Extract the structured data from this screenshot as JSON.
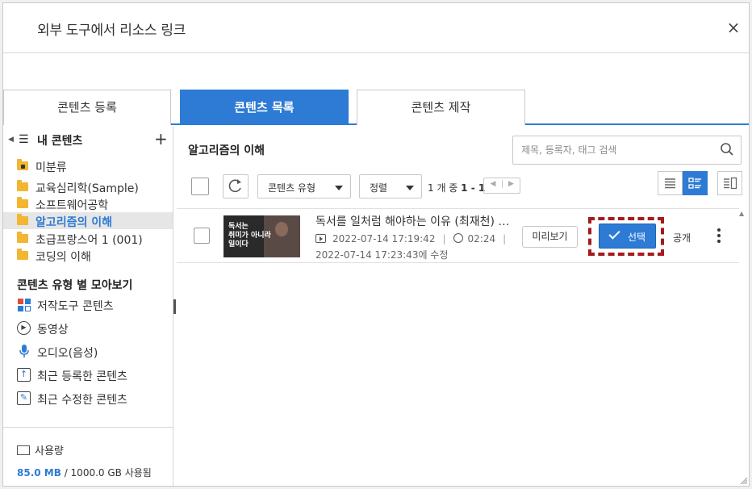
{
  "dialog": {
    "title": "외부 도구에서 리소스 링크",
    "close_symbol": "×"
  },
  "tabs": [
    {
      "label": "콘텐츠 등록",
      "active": false
    },
    {
      "label": "콘텐츠 목록",
      "active": true
    },
    {
      "label": "콘텐츠 제작",
      "active": false
    }
  ],
  "sidebar": {
    "header_label": "내 콘텐츠",
    "folders": [
      {
        "label": "미분류",
        "icon": "locked-folder-icon"
      },
      {
        "label": "교육심리학(Sample)",
        "icon": "folder-icon"
      },
      {
        "label": "소프트웨어공학",
        "icon": "folder-icon"
      },
      {
        "label": "알고리즘의 이해",
        "icon": "folder-icon",
        "selected": true
      },
      {
        "label": "초급프랑스어 1 (001)",
        "icon": "folder-icon"
      },
      {
        "label": "코딩의 이해",
        "icon": "folder-icon"
      }
    ],
    "type_section_title": "콘텐츠 유형 별 모아보기",
    "types": [
      {
        "label": "저작도구 콘텐츠",
        "icon": "authoring-tool-icon"
      },
      {
        "label": "동영상",
        "icon": "play-circle-icon"
      },
      {
        "label": "오디오(음성)",
        "icon": "microphone-icon"
      },
      {
        "label": "최근 등록한 콘텐츠",
        "icon": "upload-icon"
      },
      {
        "label": "최근 수정한 콘텐츠",
        "icon": "edit-icon"
      }
    ],
    "usage": {
      "label": "사용량",
      "used": "85.0 MB",
      "total_text": " / 1000.0 GB 사용됨"
    }
  },
  "main": {
    "folder_title": "알고리즘의 이해",
    "search_placeholder": "제목, 등록자, 태그 검색",
    "type_filter_label": "콘텐츠 유형",
    "sort_label": "정렬",
    "count_prefix": "1 개 중 ",
    "count_range": "1 - 1",
    "items": [
      {
        "thumbnail_text": "독서는\n취미가 아니라\n일이다",
        "title": "독서를 일처럼 해야하는 이유 (최재천) …",
        "created": "2022-07-14 17:19:42",
        "duration": "02:24",
        "modified": "2022-07-14 17:23:43에 수정",
        "preview_label": "미리보기",
        "select_label": "선택",
        "visibility": "공개"
      }
    ]
  },
  "colors": {
    "accent": "#2d7bd4",
    "highlight_border": "#a51b1b",
    "folder": "#f2b632"
  }
}
